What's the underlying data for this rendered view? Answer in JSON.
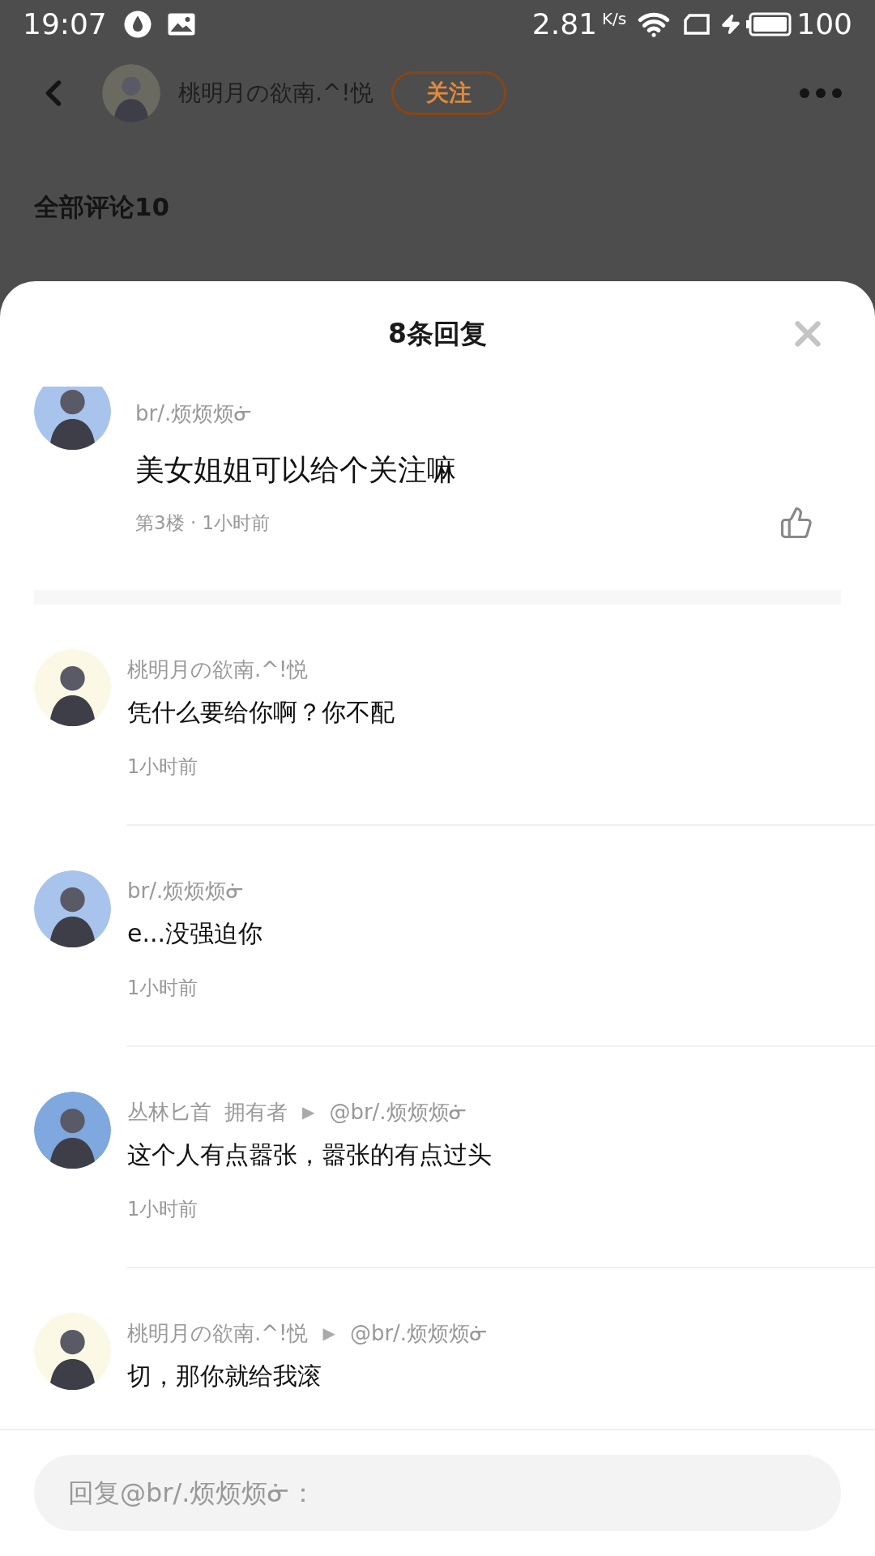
{
  "status_bar": {
    "time": "19:07",
    "speed": "2.81",
    "speed_unit": "K/s",
    "battery": "100"
  },
  "header": {
    "author": "桃明月の欲南.^!悦",
    "follow_button": "关注",
    "comments_heading": "全部评论10"
  },
  "sheet": {
    "title": "8条回复",
    "main_comment": {
      "author": "br/.烦烦烦ᓃ",
      "text": "美女姐姐可以给个关注嘛",
      "meta": "第3楼 · 1小时前",
      "color": "#a9c4ec"
    },
    "replies": [
      {
        "author": "桃明月の欲南.^!悦",
        "text": "凭什么要给你啊？你不配",
        "time": "1小时前",
        "color": "#fbf8e6"
      },
      {
        "author": "br/.烦烦烦ᓃ",
        "text": "e...没强迫你",
        "time": "1小时前",
        "color": "#a9c4ec"
      },
      {
        "author": "丛林匕首",
        "role": "拥有者",
        "arrow": "▶",
        "reply_to": "@br/.烦烦烦ᓃ",
        "text": "这个人有点嚣张，嚣张的有点过头",
        "time": "1小时前",
        "color": "#7fa8de"
      },
      {
        "author": "桃明月の欲南.^!悦",
        "arrow": "▶",
        "reply_to": "@br/.烦烦烦ᓃ",
        "text": "切，那你就给我滚",
        "color": "#fbf8e6"
      }
    ],
    "reply_field": {
      "placeholder": "回复@br/.烦烦烦ᓃ："
    }
  }
}
